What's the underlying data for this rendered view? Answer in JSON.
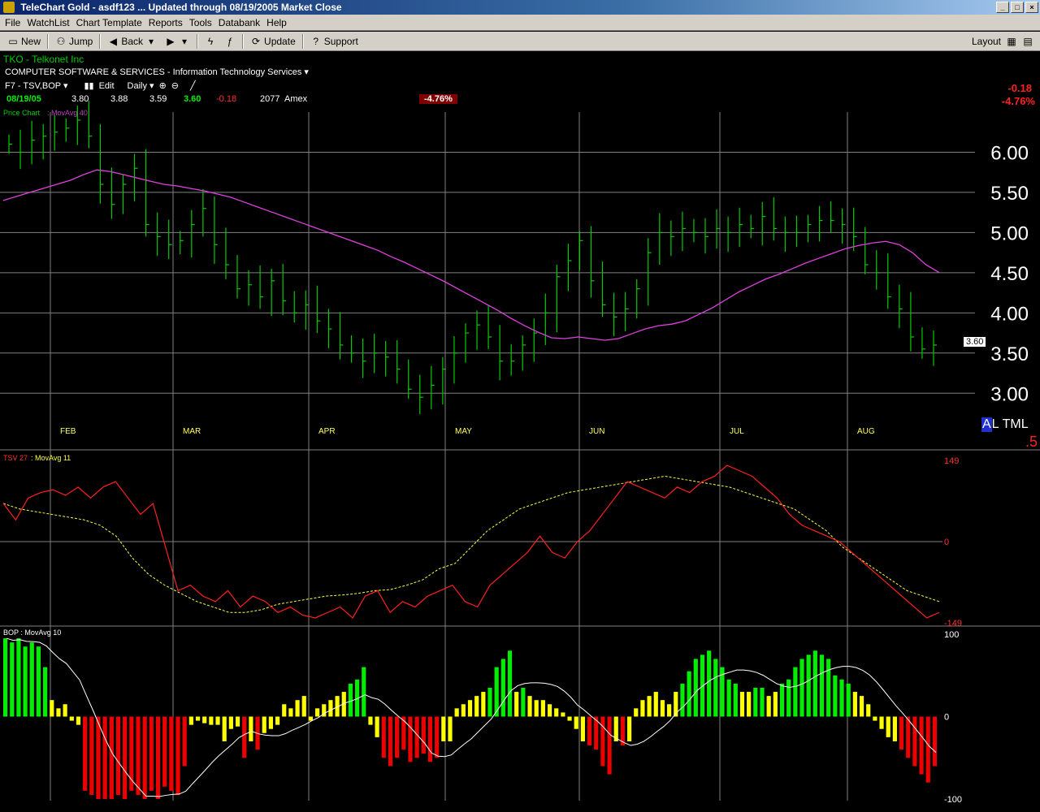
{
  "window": {
    "title": "TeleChart Gold - asdf123  ... Updated through 08/19/2005  Market Close",
    "buttons": [
      "_",
      "□",
      "×"
    ]
  },
  "menu": [
    "File",
    "WatchList",
    "Chart Template",
    "Reports",
    "Tools",
    "Databank",
    "Help"
  ],
  "toolbar": {
    "new": "New",
    "jump": "Jump",
    "back": "Back",
    "update": "Update",
    "support": "Support",
    "layout": "Layout"
  },
  "stock": {
    "symbol_line": "TKO  -  Telkonet Inc",
    "industry": "COMPUTER SOFTWARE & SERVICES - Information Technology Services",
    "template": "F7 - TSV,BOP",
    "edit": "Edit",
    "period": "Daily",
    "date": "08/19/05",
    "open": "3.80",
    "high": "3.88",
    "low": "3.59",
    "close": "3.60",
    "change": "-0.18",
    "volume": "2077",
    "exchange": "Amex",
    "pct_badge": "-4.76%",
    "right_change": "-0.18",
    "right_pct": "-4.76%",
    "last_price_tag": "3.60"
  },
  "side_tools": {
    "a": "A",
    "l": "L",
    "t": "T",
    "m": "M",
    "l2": "L",
    "five": ".5"
  },
  "colors": {
    "price": "#00cc00",
    "ma": "#e040e0",
    "tsv": "#ff2020",
    "tsv_ma": "#ffff40",
    "bop_up": "#00ee00",
    "bop_neutral": "#ffff00",
    "bop_down": "#ee0000"
  },
  "chart_data": [
    {
      "type": "bar",
      "title": "Price Chart",
      "series": [
        {
          "name": "MovAvg 40",
          "values": [
            5.4,
            5.45,
            5.5,
            5.55,
            5.6,
            5.65,
            5.72,
            5.78,
            5.76,
            5.72,
            5.68,
            5.64,
            5.6,
            5.58,
            5.55,
            5.52,
            5.48,
            5.44,
            5.38,
            5.32,
            5.26,
            5.2,
            5.14,
            5.08,
            5.02,
            4.96,
            4.9,
            4.84,
            4.78,
            4.7,
            4.63,
            4.55,
            4.47,
            4.39,
            4.3,
            4.21,
            4.12,
            4.03,
            3.93,
            3.84,
            3.76,
            3.69,
            3.68,
            3.7,
            3.68,
            3.66,
            3.68,
            3.74,
            3.8,
            3.84,
            3.86,
            3.9,
            3.98,
            4.06,
            4.16,
            4.26,
            4.34,
            4.42,
            4.48,
            4.55,
            4.62,
            4.68,
            4.74,
            4.8,
            4.84,
            4.87,
            4.89,
            4.85,
            4.75,
            4.6,
            4.5
          ]
        }
      ],
      "closes": [
        6.1,
        6.0,
        6.15,
        6.2,
        6.25,
        6.3,
        6.4,
        6.2,
        5.6,
        5.35,
        5.6,
        5.8,
        5.1,
        4.95,
        4.85,
        4.9,
        5.1,
        5.3,
        4.85,
        4.6,
        4.3,
        4.35,
        4.2,
        4.4,
        4.15,
        4.0,
        4.1,
        3.9,
        3.8,
        3.6,
        3.5,
        3.4,
        3.5,
        3.45,
        3.3,
        3.05,
        2.95,
        3.1,
        3.3,
        3.5,
        3.75,
        3.85,
        3.7,
        3.4,
        3.4,
        3.6,
        3.75,
        4.0,
        4.45,
        4.65,
        4.9,
        4.4,
        4.1,
        3.95,
        4.05,
        4.3,
        4.75,
        5.0,
        4.95,
        5.05,
        5.0,
        4.95,
        5.05,
        5.0,
        5.1,
        5.05,
        5.2,
        5.05,
        5.0,
        5.0,
        5.1,
        5.15,
        5.15,
        5.1,
        4.95,
        4.6,
        4.5,
        4.2,
        4.05,
        3.7,
        3.55,
        3.6
      ],
      "months": [
        "FEB",
        "MAR",
        "APR",
        "MAY",
        "JUN",
        "JUL",
        "AUG"
      ],
      "y_ticks": [
        "6.00",
        "5.50",
        "5.00",
        "4.50",
        "4.00",
        "3.50",
        "3.00"
      ],
      "ylim": [
        2.75,
        6.5
      ]
    },
    {
      "type": "line",
      "title": "TSV 27",
      "series": [
        {
          "name": "TSV 27",
          "values": [
            70,
            40,
            80,
            90,
            95,
            85,
            100,
            80,
            100,
            110,
            80,
            50,
            70,
            -10,
            -90,
            -80,
            -100,
            -110,
            -90,
            -120,
            -100,
            -110,
            -130,
            -120,
            -135,
            -140,
            -130,
            -120,
            -140,
            -100,
            -90,
            -130,
            -110,
            -120,
            -100,
            -90,
            -80,
            -110,
            -120,
            -80,
            -60,
            -40,
            -20,
            10,
            -20,
            -30,
            0,
            20,
            50,
            80,
            110,
            100,
            90,
            80,
            100,
            90,
            110,
            120,
            140,
            130,
            120,
            100,
            80,
            50,
            30,
            20,
            10,
            0,
            -20,
            -40,
            -60,
            -80,
            -100,
            -120,
            -140,
            -130
          ],
          "ma": [
            70,
            60,
            55,
            50,
            45,
            40,
            30,
            10,
            -30,
            -60,
            -80,
            -95,
            -110,
            -120,
            -130,
            -130,
            -125,
            -115,
            -110,
            -105,
            -100,
            -98,
            -95,
            -90,
            -88,
            -80,
            -70,
            -50,
            -40,
            -10,
            20,
            40,
            60,
            70,
            80,
            90,
            95,
            100,
            105,
            110,
            115,
            120,
            115,
            110,
            105,
            100,
            90,
            80,
            70,
            60,
            40,
            20,
            -10,
            -30,
            -50,
            -70,
            -90,
            -100,
            -110
          ]
        }
      ],
      "y_ticks": [
        "149",
        "0",
        "-149"
      ],
      "ylim": [
        -149,
        149
      ]
    },
    {
      "type": "bar",
      "title": "BOP",
      "series": [
        {
          "name": "BOP",
          "values": [
            95,
            90,
            95,
            85,
            90,
            85,
            60,
            20,
            10,
            15,
            -5,
            -10,
            -90,
            -95,
            -100,
            -100,
            -100,
            -95,
            -100,
            -90,
            -95,
            -100,
            -90,
            -100,
            -85,
            -90,
            -95,
            -60,
            -10,
            -5,
            -8,
            -10,
            -10,
            -30,
            -15,
            -12,
            -50,
            -30,
            -40,
            -20,
            -15,
            -10,
            15,
            10,
            20,
            25,
            -5,
            10,
            15,
            20,
            25,
            30,
            40,
            45,
            60,
            -10,
            -25,
            -50,
            -60,
            -50,
            -40,
            -55,
            -50,
            -45,
            -55,
            -50,
            -30,
            -30,
            10,
            15,
            20,
            25,
            30,
            35,
            60,
            70,
            80,
            30,
            35,
            25,
            20,
            20,
            15,
            10,
            5,
            -5,
            -15,
            -30,
            -35,
            -40,
            -60,
            -70,
            -30,
            -35,
            -30,
            10,
            20,
            25,
            30,
            20,
            15,
            30,
            40,
            55,
            70,
            75,
            80,
            70,
            60,
            45,
            40,
            30,
            30,
            35,
            35,
            25,
            30,
            40,
            45,
            60,
            70,
            75,
            80,
            75,
            70,
            50,
            45,
            40,
            30,
            25,
            15,
            -5,
            -15,
            -25,
            -30,
            -40,
            -50,
            -60,
            -70,
            -80,
            -60
          ]
        }
      ],
      "y_ticks": [
        "100",
        "0",
        "-100"
      ],
      "ylim": [
        -100,
        100
      ]
    }
  ],
  "pane_labels": {
    "price": "Price Chart",
    "price_ma": "MovAvg 40",
    "tsv": "TSV 27",
    "tsv_ma": "MovAvg 11",
    "bop": "BOP",
    "bop_ma": "MovAvg 10"
  }
}
